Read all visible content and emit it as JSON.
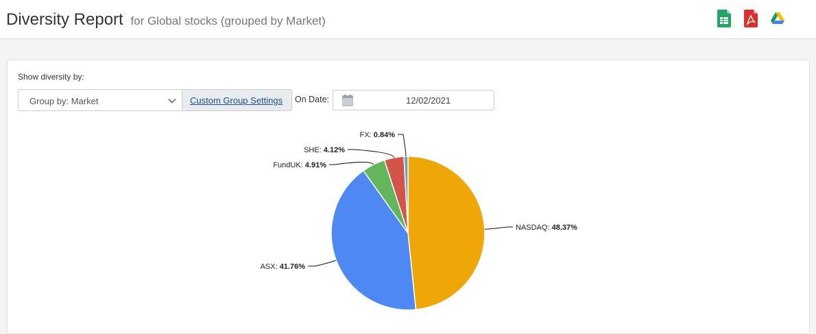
{
  "header": {
    "title": "Diversity Report",
    "subtitle": "for Global stocks (grouped by Market)"
  },
  "controls": {
    "show_label": "Show diversity by:",
    "group_by_value": "Group by: Market",
    "custom_group_label": "Custom Group Settings",
    "on_date_label": "On Date:",
    "date_value": "12/02/2021"
  },
  "colors": {
    "NASDAQ": "#EFA607",
    "ASX": "#4E88F2",
    "FundUK": "#63B65C",
    "SHE": "#D35448",
    "FX": "#6A9FC2"
  },
  "chart_data": {
    "type": "pie",
    "categories": [
      "NASDAQ",
      "ASX",
      "FundUK",
      "SHE",
      "FX"
    ],
    "values": [
      48.37,
      41.76,
      4.91,
      4.12,
      0.84
    ],
    "value_labels": [
      "48.37%",
      "41.76%",
      "4.91%",
      "4.12%",
      "0.84%"
    ]
  }
}
